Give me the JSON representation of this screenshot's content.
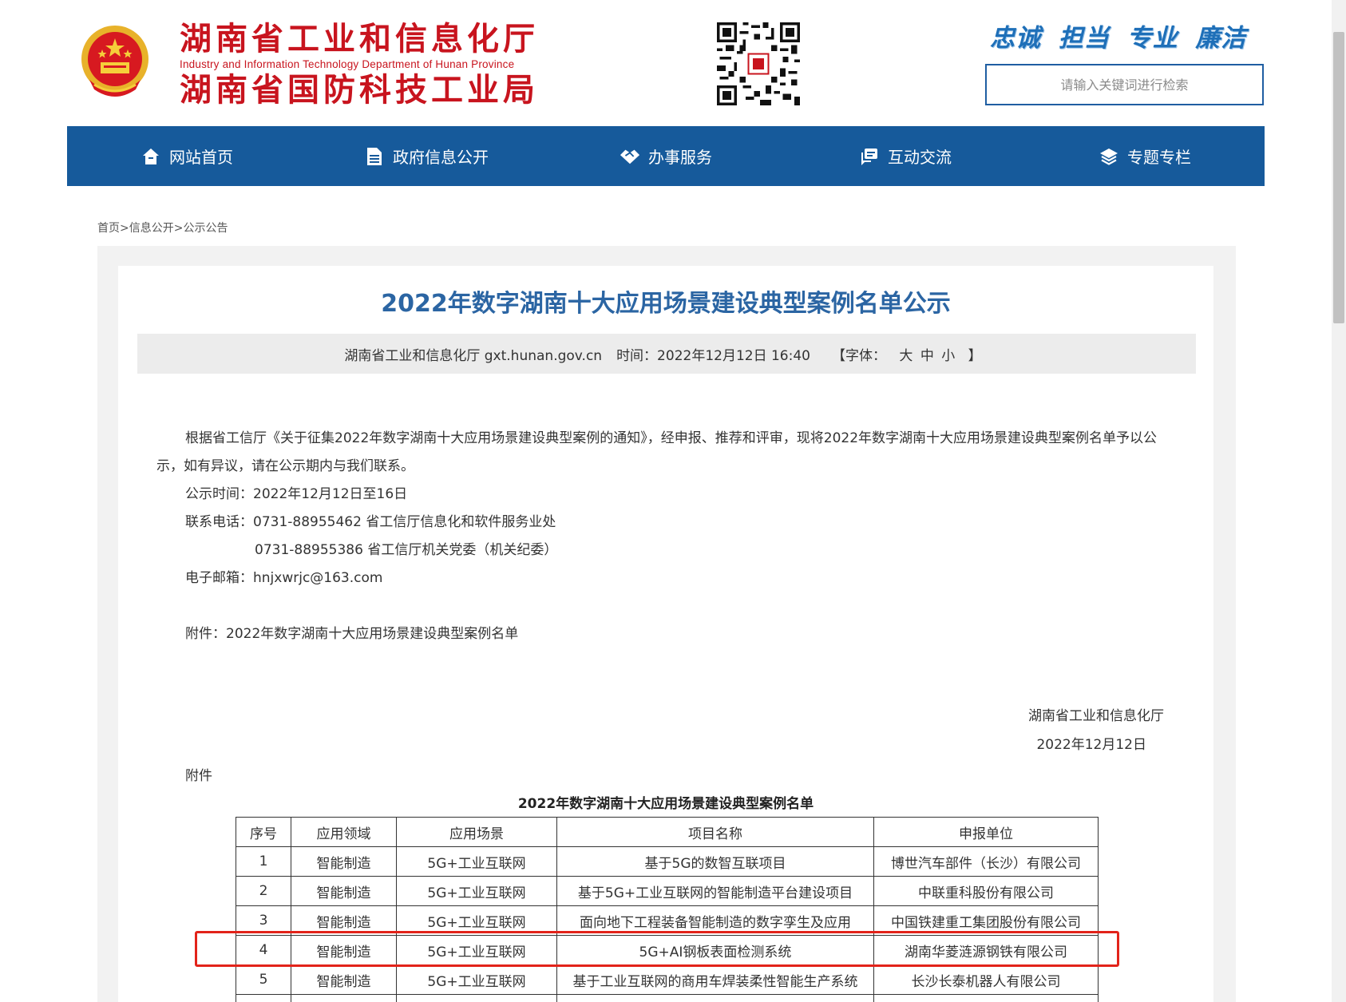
{
  "header": {
    "title_line1": "湖南省工业和信息化厅",
    "title_en": "Industry and Information Technology Department of Hunan Province",
    "title_line2": "湖南省国防科技工业局",
    "slogan": "忠诚 担当 专业 廉洁",
    "search_placeholder": "请输入关键词进行检索"
  },
  "nav": [
    {
      "label": "网站首页",
      "icon": "home-icon"
    },
    {
      "label": "政府信息公开",
      "icon": "document-icon"
    },
    {
      "label": "办事服务",
      "icon": "handshake-icon"
    },
    {
      "label": "互动交流",
      "icon": "chat-icon"
    },
    {
      "label": "专题专栏",
      "icon": "layers-icon"
    }
  ],
  "breadcrumb": {
    "home": "首页",
    "sep": ">",
    "level1": "信息公开",
    "level2": "公示公告"
  },
  "article": {
    "title": "2022年数字湖南十大应用场景建设典型案例名单公示",
    "meta": {
      "source": "湖南省工业和信息化厅 gxt.hunan.gov.cn",
      "time": "时间：2022年12月12日 16:40",
      "font_label": "【字体：",
      "font_large": "大",
      "font_medium": "中",
      "font_small": "小",
      "font_close": "】"
    },
    "paragraph1": "根据省工信厅《关于征集2022年数字湖南十大应用场景建设典型案例的通知》，经申报、推荐和评审，现将2022年数字湖南十大应用场景建设典型案例名单予以公示，如有异议，请在公示期内与我们联系。",
    "notice_period": "公示时间：2022年12月12日至16日",
    "phone1": "联系电话：0731-88955462 省工信厅信息化和软件服务业处",
    "phone2": "0731-88955386 省工信厅机关党委（机关纪委）",
    "email": "电子邮箱：hnjxwrjc@163.com",
    "attachment": "附件：2022年数字湖南十大应用场景建设典型案例名单",
    "signature_org": "湖南省工业和信息化厅",
    "signature_date": "2022年12月12日",
    "attach_label": "附件",
    "table_title": "2022年数字湖南十大应用场景建设典型案例名单"
  },
  "table": {
    "headers": [
      "序号",
      "应用领域",
      "应用场景",
      "项目名称",
      "申报单位"
    ],
    "rows": [
      [
        "1",
        "智能制造",
        "5G+工业互联网",
        "基于5G的数智互联项目",
        "博世汽车部件（长沙）有限公司"
      ],
      [
        "2",
        "智能制造",
        "5G+工业互联网",
        "基于5G+工业互联网的智能制造平台建设项目",
        "中联重科股份有限公司"
      ],
      [
        "3",
        "智能制造",
        "5G+工业互联网",
        "面向地下工程装备智能制造的数字孪生及应用",
        "中国铁建重工集团股份有限公司"
      ],
      [
        "4",
        "智能制造",
        "5G+工业互联网",
        "5G+AI钢板表面检测系统",
        "湖南华菱涟源钢铁有限公司"
      ],
      [
        "5",
        "智能制造",
        "5G+工业互联网",
        "基于工业互联网的商用车焊装柔性智能生产系统",
        "长沙长泰机器人有限公司"
      ]
    ]
  },
  "colors": {
    "brand_red": "#c8141e",
    "nav_blue": "#165a9b",
    "title_blue": "#2b65a3",
    "highlight_red": "#e2231a"
  }
}
